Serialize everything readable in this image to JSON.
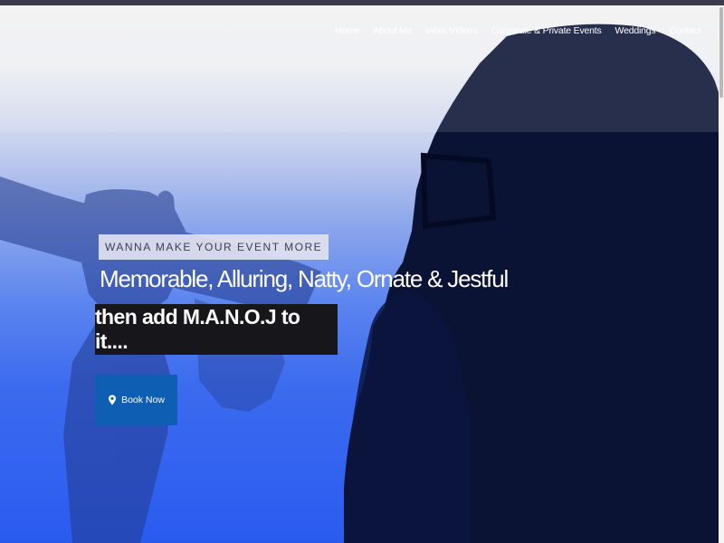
{
  "nav": {
    "items": [
      {
        "label": "Home"
      },
      {
        "label": "About Me"
      },
      {
        "label": "Work Videos"
      },
      {
        "label": "Corporate & Private Events"
      },
      {
        "label": "Weddings"
      },
      {
        "label": "Contact"
      }
    ]
  },
  "hero": {
    "tagline": "WANNA MAKE YOUR EVENT MORE",
    "headline": "Memorable, Alluring, Natty, Ornate & Jestful",
    "subline": "then add M.A.N.O.J to it....",
    "cta": {
      "label": "Book Now",
      "icon": "map-pin-icon"
    }
  },
  "colors": {
    "hero_top": "#f2f2f2",
    "hero_bottom": "#2a5bf0",
    "button": "#0e5fb3",
    "subline_bg": "#16161b",
    "tag_bg": "#e1e2ec"
  }
}
